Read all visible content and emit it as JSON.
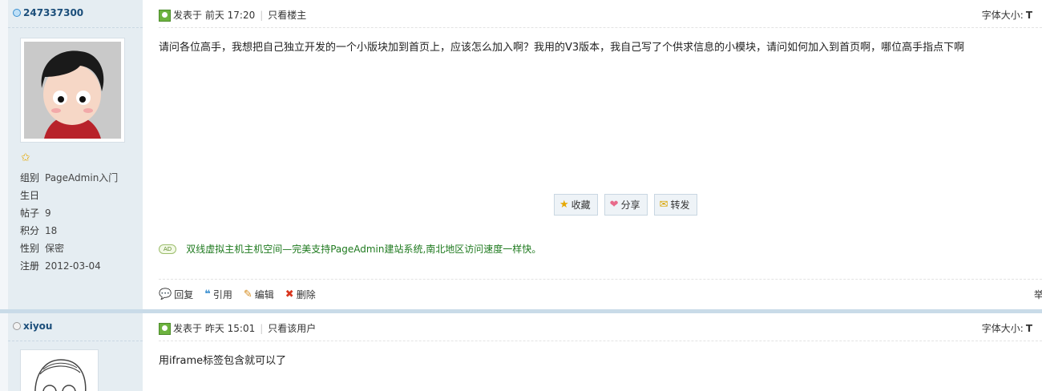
{
  "posts": [
    {
      "username": "247337300",
      "group_label": "组别",
      "group_value": "PageAdmin入门",
      "birthday_label": "生日",
      "birthday_value": "",
      "posts_label": "帖子",
      "posts_value": "9",
      "points_label": "积分",
      "points_value": "18",
      "gender_label": "性别",
      "gender_value": "保密",
      "register_label": "注册",
      "register_value": "2012-03-04",
      "posted_label": "发表于 前天 17:20",
      "view_only_label": "只看楼主",
      "font_size_label": "字体大小:",
      "font_size_value": "T",
      "content": "请问各位高手，我想把自己独立开发的一个小版块加到首页上，应该怎么加入啊？我用的V3版本，我自己写了个供求信息的小模块，请问如何加入到首页啊，哪位高手指点下啊",
      "favorite_label": "收藏",
      "share_label": "分享",
      "forward_label": "转发",
      "ad_badge": "AD",
      "ad_text": "双线虚拟主机主机空间—完美支持PageAdmin建站系统,南北地区访问速度一样快。",
      "reply_label": "回复",
      "quote_label": "引用",
      "edit_label": "编辑",
      "delete_label": "删除",
      "report_label": "举"
    },
    {
      "username": "xiyou",
      "posted_label": "发表于 昨天 15:01",
      "view_only_label": "只看该用户",
      "font_size_label": "字体大小:",
      "font_size_value": "T",
      "content": "用iframe标签包含就可以了"
    }
  ],
  "colors": {
    "sidebar_bg": "#e5edf2",
    "separator": "#c9dbe8",
    "ad_text": "#1f7a1f",
    "username": "#1b4e7a"
  },
  "icons": {
    "online": "online-status-icon",
    "offline": "offline-status-icon",
    "star": "star-icon",
    "posted": "posted-icon",
    "favorite": "star-icon",
    "share": "heart-icon",
    "forward": "envelope-icon",
    "reply": "speech-bubble-icon",
    "quote": "quote-icon",
    "edit": "pencil-icon",
    "delete": "cross-icon"
  }
}
